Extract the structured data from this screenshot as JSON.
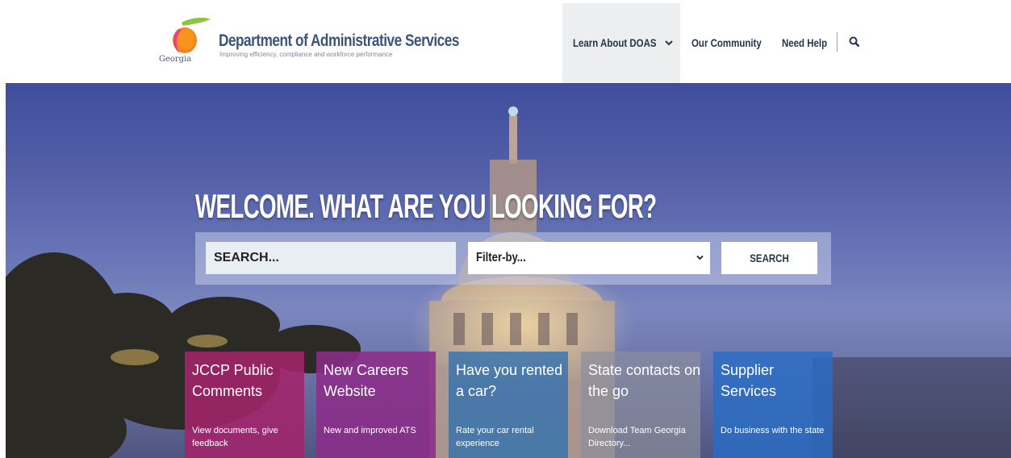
{
  "header": {
    "logo_text": "Georgia",
    "title": "Department of Administrative Services",
    "subtitle": "Improving efficiency, compliance and workforce performance",
    "nav": [
      {
        "label": "Learn About DOAS",
        "has_dropdown": true
      },
      {
        "label": "Our Community"
      },
      {
        "label": "Need Help"
      }
    ],
    "search_icon": "search-icon",
    "colors": {
      "brand_title": "#3d5379",
      "nav_active_bg": "#eceeef"
    }
  },
  "hero": {
    "welcome": "WELCOME. WHAT ARE YOU LOOKING FOR?",
    "search": {
      "placeholder": "SEARCH...",
      "value": ""
    },
    "filter": {
      "selected": "Filter-by...",
      "icon": "chevron-down-icon"
    },
    "search_button": "SEARCH"
  },
  "cards": [
    {
      "title": "JCCP Public Comments",
      "desc": "View documents, give feedback",
      "color": "#a3236b"
    },
    {
      "title": "New Careers Website",
      "desc": "New and improved ATS",
      "color": "#8c2c8a"
    },
    {
      "title": "Have you rented a car?",
      "desc": "Rate your car rental experience",
      "color": "#2f6fae"
    },
    {
      "title": "State contacts on the go",
      "desc": "Download Team Georgia Directory...",
      "color": "#8c8e9c"
    },
    {
      "title": "Supplier Services",
      "desc": "Do business with the state",
      "color": "#2a6cc6"
    }
  ]
}
